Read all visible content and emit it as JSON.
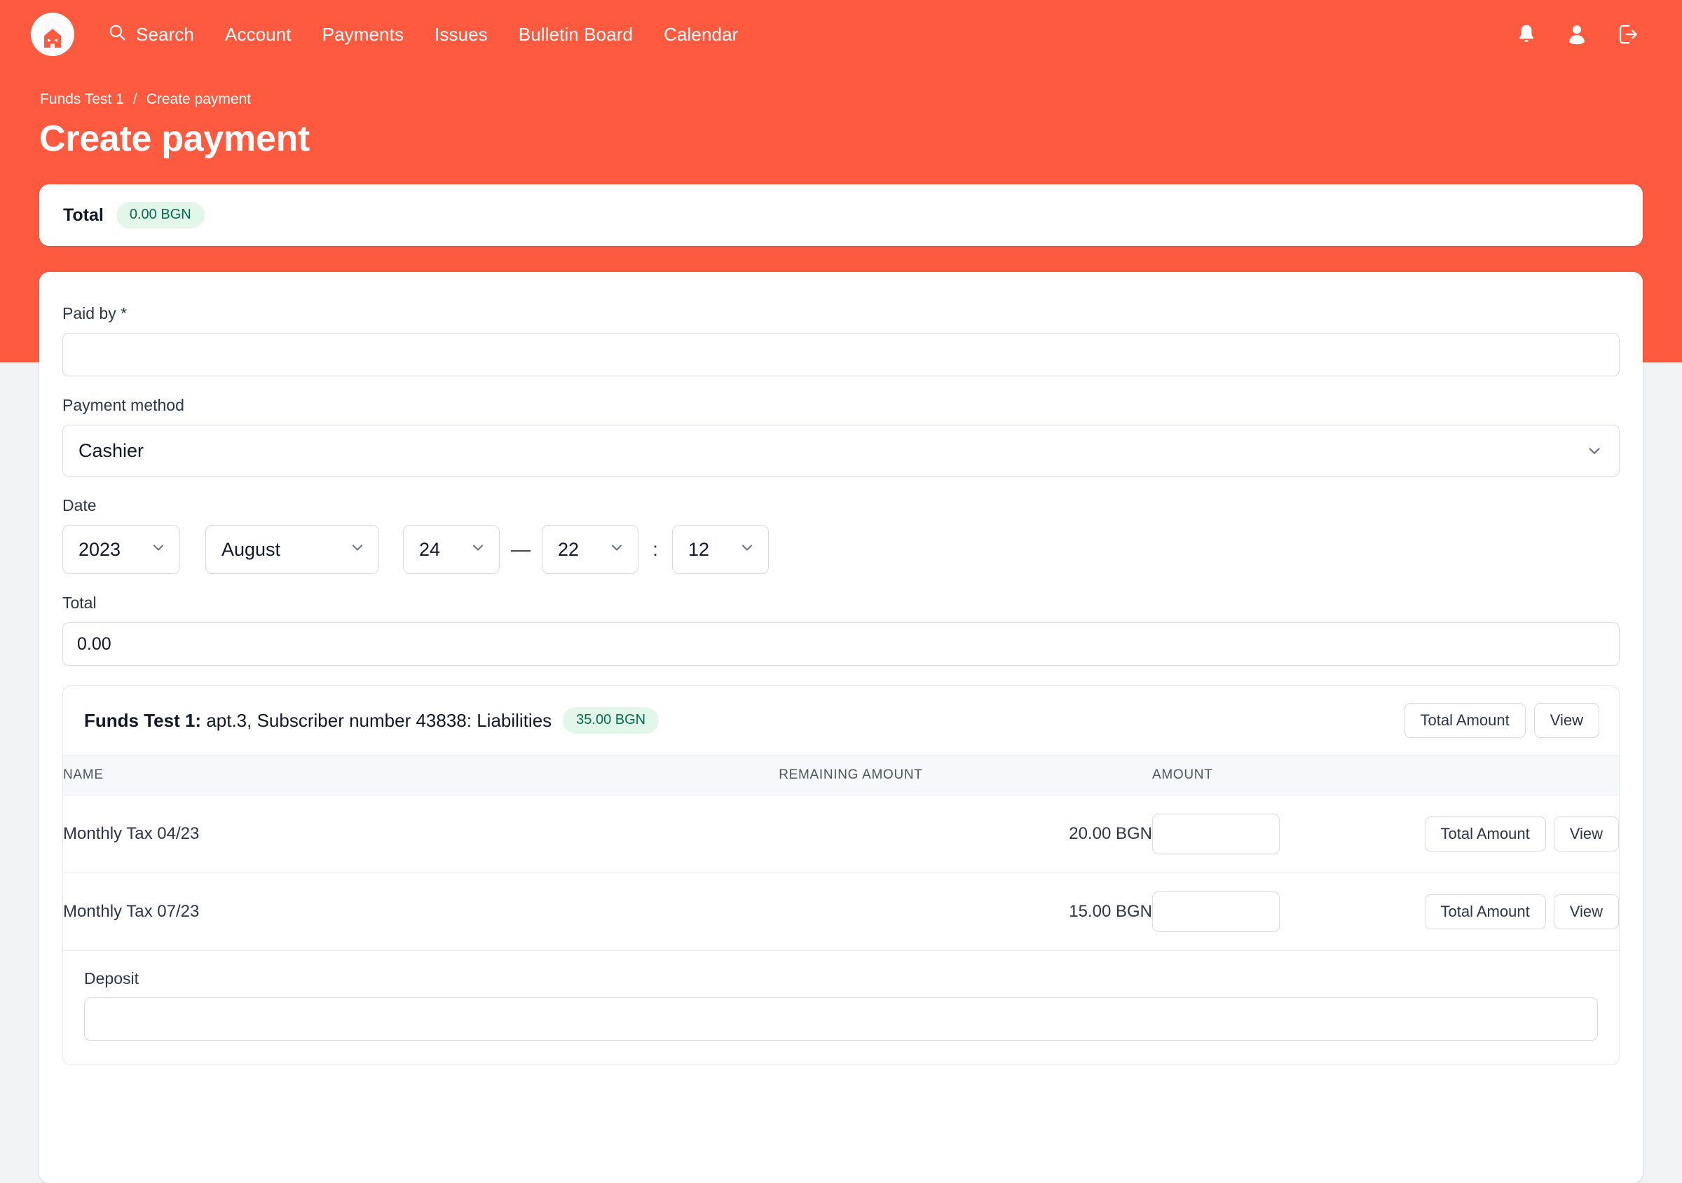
{
  "colors": {
    "brand_orange": "#fd5a40",
    "page_bg": "#f2f3f5",
    "badge_bg": "#e3f6ea",
    "badge_text": "#046c4e",
    "text_dark": "#101828",
    "border": "#d7dae0"
  },
  "navbar": {
    "logo_name": "flame-house-logo",
    "search": {
      "label": "Search",
      "icon": "search-icon"
    },
    "links": [
      {
        "label": "Account"
      },
      {
        "label": "Payments"
      },
      {
        "label": "Issues"
      },
      {
        "label": "Bulletin Board"
      },
      {
        "label": "Calendar"
      }
    ],
    "right_icons": [
      {
        "name": "notifications-bell-icon"
      },
      {
        "name": "user-profile-icon"
      },
      {
        "name": "logout-icon"
      }
    ]
  },
  "breadcrumb": {
    "parent": "Funds Test 1",
    "separator": "/",
    "current": "Create payment"
  },
  "page_title": "Create payment",
  "total_card": {
    "label": "Total",
    "badge": "0.00 BGN"
  },
  "form": {
    "paid_by": {
      "label": "Paid by *",
      "value": "",
      "placeholder": ""
    },
    "payment_method": {
      "label": "Payment method",
      "value": "Cashier"
    },
    "date": {
      "label": "Date",
      "year": "2023",
      "month": "August",
      "day": "24",
      "separator": "—",
      "hour": "22",
      "time_separator": ":",
      "minute": "12"
    },
    "total": {
      "label": "Total",
      "value": "0.00"
    }
  },
  "liabilities": {
    "title_bold": "Funds Test 1:",
    "title_rest": " apt.3, Subscriber number 43838: Liabilities",
    "badge": "35.00 BGN",
    "header_buttons": [
      {
        "label": "Total Amount"
      },
      {
        "label": "View"
      }
    ],
    "columns": {
      "name": "NAME",
      "remaining": "REMAINING AMOUNT",
      "amount": "AMOUNT",
      "actions": ""
    },
    "rows": [
      {
        "name": "Monthly Tax 04/23",
        "remaining": "20.00 BGN",
        "amount_value": "",
        "buttons": [
          {
            "label": "Total Amount"
          },
          {
            "label": "View"
          }
        ]
      },
      {
        "name": "Monthly Tax 07/23",
        "remaining": "15.00 BGN",
        "amount_value": "",
        "buttons": [
          {
            "label": "Total Amount"
          },
          {
            "label": "View"
          }
        ]
      }
    ],
    "deposit": {
      "label": "Deposit",
      "value": ""
    }
  }
}
